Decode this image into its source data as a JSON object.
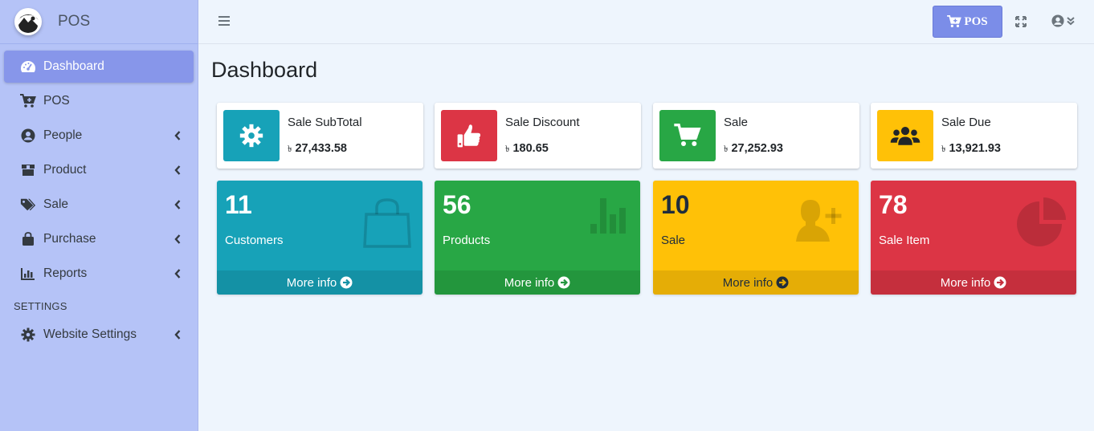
{
  "brand": {
    "title": "POS"
  },
  "sidebar": {
    "items": [
      {
        "label": "Dashboard",
        "icon": "tachometer-icon",
        "active": true
      },
      {
        "label": "POS",
        "icon": "cart-plus-icon"
      },
      {
        "label": "People",
        "icon": "user-circle-icon"
      },
      {
        "label": "Product",
        "icon": "box-icon"
      },
      {
        "label": "Sale",
        "icon": "tags-icon"
      },
      {
        "label": "Purchase",
        "icon": "shopping-bag-icon"
      },
      {
        "label": "Reports",
        "icon": "chart-bar-icon"
      }
    ],
    "section_header": "SETTINGS",
    "settings_item": {
      "label": "Website Settings",
      "icon": "gear-icon"
    }
  },
  "topbar": {
    "pos_button_label": "POS"
  },
  "page": {
    "title": "Dashboard"
  },
  "info_boxes": [
    {
      "label": "Sale SubTotal",
      "currency": "৳",
      "value": "27,433.58",
      "color": "#17a2b8",
      "icon": "gear-icon"
    },
    {
      "label": "Sale Discount",
      "currency": "৳",
      "value": "180.65",
      "color": "#dc3545",
      "icon": "thumbs-up-icon"
    },
    {
      "label": "Sale",
      "currency": "৳",
      "value": "27,252.93",
      "color": "#28a745",
      "icon": "cart-icon"
    },
    {
      "label": "Sale Due",
      "currency": "৳",
      "value": "13,921.93",
      "color": "#ffc107",
      "icon": "users-icon"
    }
  ],
  "small_boxes": [
    {
      "number": "11",
      "label": "Customers",
      "footer": "More info",
      "color": "#17a2b8",
      "icon": "shopping-bag-icon"
    },
    {
      "number": "56",
      "label": "Products",
      "footer": "More info",
      "color": "#28a745",
      "icon": "stats-bars-icon"
    },
    {
      "number": "10",
      "label": "Sale",
      "footer": "More info",
      "color": "#ffc107",
      "icon": "person-add-icon"
    },
    {
      "number": "78",
      "label": "Sale Item",
      "footer": "More info",
      "color": "#dc3545",
      "icon": "pie-graph-icon"
    }
  ]
}
